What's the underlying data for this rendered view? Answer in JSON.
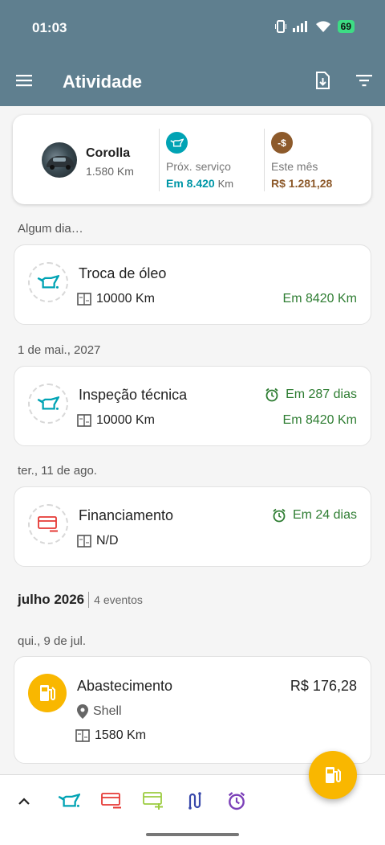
{
  "status_bar": {
    "time": "01:03",
    "battery": "69"
  },
  "app_bar": {
    "title": "Atividade",
    "icons": [
      "menu-icon",
      "download-report-icon",
      "filter-icon"
    ]
  },
  "summary": {
    "vehicle_name": "Corolla",
    "vehicle_km": "1.580 Km",
    "next_service": {
      "label": "Próx. serviço",
      "value": "Em 8.420",
      "unit": "Km",
      "color": "#0097a7"
    },
    "this_month": {
      "label": "Este mês",
      "value": "R$ 1.281,28",
      "color": "#8d5a2b"
    }
  },
  "groups": [
    {
      "date": "Algum dia…",
      "cards": [
        {
          "title": "Troca de óleo",
          "odometer": "10000 Km",
          "due_km": "Em 8420 Km",
          "icon": "oil-can-icon"
        }
      ]
    },
    {
      "date": "1 de mai., 2027",
      "cards": [
        {
          "title": "Inspeção técnica",
          "odometer": "10000 Km",
          "due_days": "Em 287 dias",
          "due_km": "Em 8420 Km",
          "icon": "oil-can-icon"
        }
      ]
    },
    {
      "date": "ter., 11 de ago.",
      "cards": [
        {
          "title": "Financiamento",
          "odometer": "N/D",
          "due_days": "Em 24 dias",
          "icon": "card-minus-icon"
        }
      ]
    }
  ],
  "month": {
    "title": "julho 2026",
    "events": "4 eventos"
  },
  "day": {
    "date": "qui., 9 de jul.",
    "card": {
      "title": "Abastecimento",
      "amount": "R$ 176,28",
      "station": "Shell",
      "odometer": "1580 Km",
      "icon": "fuel-pump-icon"
    }
  },
  "bottom_bar": [
    "expand-up-icon",
    "add-service-icon",
    "add-expense-icon",
    "add-income-icon",
    "add-route-icon",
    "add-reminder-icon"
  ],
  "colors": {
    "header": "#5f7f8f",
    "teal": "#00a3b4",
    "red": "#e53935",
    "lime": "#9ccc40",
    "indigo": "#3949ab",
    "purple": "#7b3fb8",
    "green": "#2e7d32",
    "fuel": "#f9b700"
  }
}
